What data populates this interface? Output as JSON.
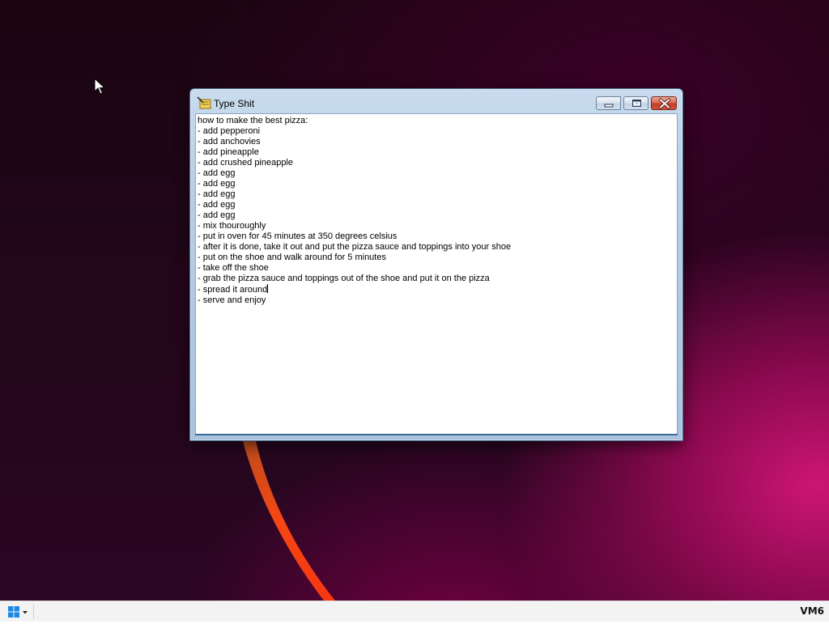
{
  "window": {
    "title": "Type Shit",
    "lines": [
      "how to make the best pizza:",
      "- add pepperoni",
      "- add anchovies",
      "- add pineapple",
      "- add crushed pineapple",
      "- add egg",
      "- add egg",
      "- add egg",
      "- add egg",
      "- add egg",
      "- mix thouroughly",
      "- put in oven for 45 minutes at 350 degrees celsius",
      "- after it is done, take it out and put the pizza sauce and toppings into your shoe",
      "- put on the shoe and walk around for 5 minutes",
      "- take off the shoe",
      "- grab the pizza sauce and toppings out of the shoe and put it on the pizza",
      "- spread it around",
      "- serve and enjoy"
    ]
  },
  "icons": {
    "app": "notepad-icon",
    "minimize": "minimize-icon",
    "maximize": "maximize-icon",
    "close": "close-icon",
    "start": "windows-logo-icon",
    "cursor": "mouse-pointer-icon"
  },
  "taskbar": {
    "tray_label": "VM6"
  },
  "colors": {
    "close_button": "#c13b22",
    "title_bar": "#b6cde4",
    "start_logo": "#1e88e5"
  }
}
